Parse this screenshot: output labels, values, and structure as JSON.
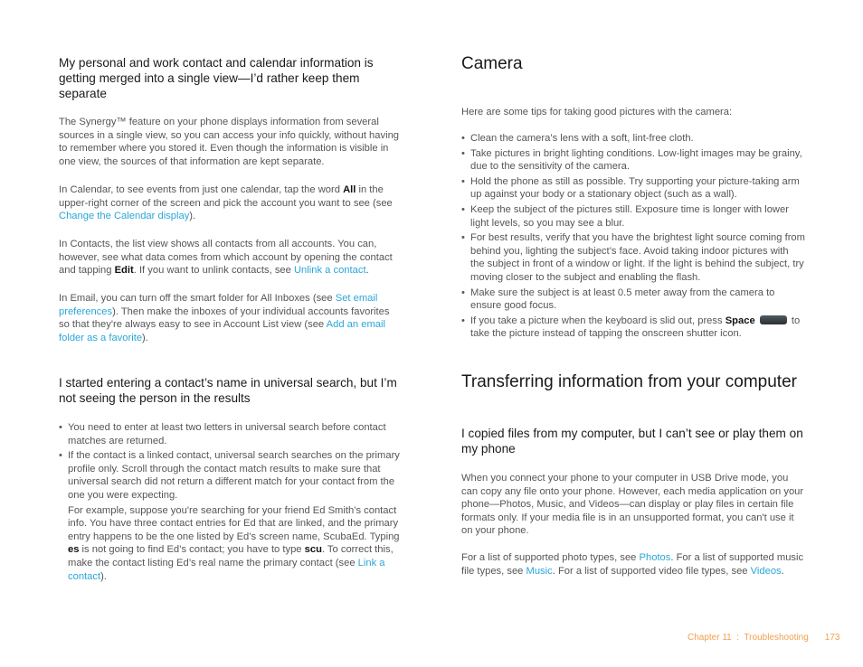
{
  "left": {
    "q1": {
      "heading": "My personal and work contact and calendar information is getting merged into a single view—I’d rather keep them separate",
      "p1": "The Synergy™ feature on your phone displays information from several sources in a single view, so you can access your info quickly, without having to remember where you stored it. Even though the information is visible in one view, the sources of that information are kept separate.",
      "p2_a": "In Calendar, to see events from just one calendar, tap the word ",
      "p2_bold": "All",
      "p2_b": " in the upper-right corner of the screen and pick the account you want to see (see ",
      "p2_link": "Change the Calendar display",
      "p2_c": ").",
      "p3_a": "In Contacts, the list view shows all contacts from all accounts. You can, however, see what data comes from which account by opening the contact and tapping ",
      "p3_bold": "Edit",
      "p3_b": ". If you want to unlink contacts, see ",
      "p3_link": "Unlink a contact",
      "p3_c": ".",
      "p4_a": "In Email, you can turn off the smart folder for All Inboxes (see ",
      "p4_link1": "Set email preferences",
      "p4_b": "). Then make the inboxes of your individual accounts favorites so that they're always easy to see in Account List view (see ",
      "p4_link2": "Add an email folder as a favorite",
      "p4_c": ")."
    },
    "q2": {
      "heading": "I started entering a contact’s name in universal search, but I’m not seeing the person in the results",
      "bullet1": "You need to enter at least two letters in universal search before contact matches are returned.",
      "bullet2": "If the contact is a linked contact, universal search searches on the primary profile only. Scroll through the contact match results to make sure that universal search did not return a different match for your contact from the one you were expecting.",
      "ex_a": "For example, suppose you're searching for your friend Ed Smith’s contact info. You have three contact entries for Ed that are linked, and the primary entry happens to be the one listed by Ed’s screen name, ScubaEd. Typing ",
      "ex_bold1": "es",
      "ex_b": " is not going to find Ed’s contact; you have to type ",
      "ex_bold2": "scu",
      "ex_c": ". To correct this, make the contact listing Ed’s real name the primary contact (see ",
      "ex_link": "Link a contact",
      "ex_d": ")."
    }
  },
  "right": {
    "camera": {
      "heading": "Camera",
      "intro": "Here are some tips for taking good pictures with the camera:",
      "bullets": [
        "Clean the camera’s lens with a soft, lint-free cloth.",
        "Take pictures in bright lighting conditions. Low-light images may be grainy, due to the sensitivity of the camera.",
        "Hold the phone as still as possible. Try supporting your picture-taking arm up against your body or a stationary object (such as a wall).",
        "Keep the subject of the pictures still. Exposure time is longer with lower light levels, so you may see a blur.",
        "For best results, verify that you have the brightest light source coming from behind you, lighting the subject’s face. Avoid taking indoor pictures with the subject in front of a window or light. If the light is behind the subject, try moving closer to the subject and enabling the flash.",
        "Make sure the subject is at least 0.5 meter away from the camera to ensure good focus."
      ],
      "last_a": "If you take a picture when the keyboard is slid out, press ",
      "last_bold": "Space",
      "last_b": " to take the picture instead of tapping the onscreen shutter icon."
    },
    "transfer": {
      "heading": "Transferring information from your computer",
      "q": "I copied files from my computer, but I can’t see or play them on my phone",
      "p1": "When you connect your phone to your computer in USB Drive mode, you can copy any file onto your phone. However, each media application on your phone—Photos, Music, and Videos—can display or play files in certain file formats only. If your media file is in an unsupported format, you can't use it on your phone.",
      "p2_a": "For a list of supported photo types, see ",
      "p2_link1": "Photos",
      "p2_b": ". For a list of supported music file types, see ",
      "p2_link2": "Music",
      "p2_c": ". For a list of supported video file types, see ",
      "p2_link3": "Videos",
      "p2_d": "."
    }
  },
  "footer": {
    "chapter": "Chapter 11  :  Troubleshooting",
    "page": "173"
  },
  "colors": {
    "link": "#2aa6d8",
    "footer": "#f0a050"
  }
}
